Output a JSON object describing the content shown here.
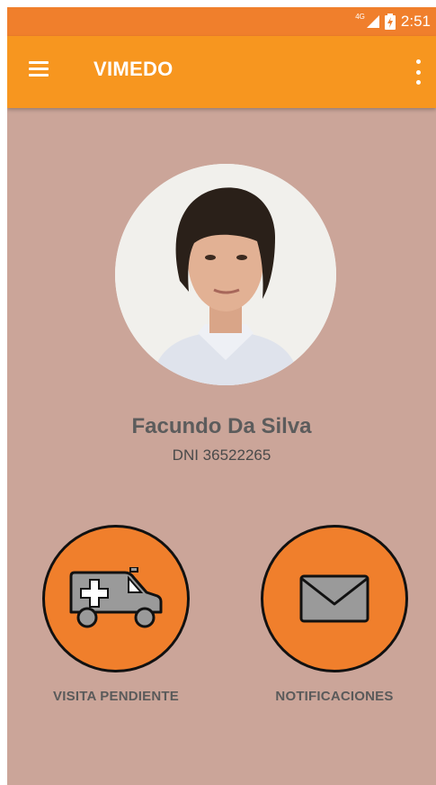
{
  "statusbar": {
    "network": "4G",
    "time": "2:51"
  },
  "appbar": {
    "title": "VIMEDO"
  },
  "profile": {
    "name": "Facundo Da Silva",
    "dni": "DNI 36522265"
  },
  "actions": [
    {
      "label": "VISITA PENDIENTE",
      "icon": "ambulance-icon"
    },
    {
      "label": "NOTIFICACIONES",
      "icon": "envelope-icon"
    }
  ],
  "colors": {
    "statusbar": "#f07f2c",
    "appbar": "#f7961f",
    "background": "#cba599",
    "button": "#f07f2c"
  }
}
